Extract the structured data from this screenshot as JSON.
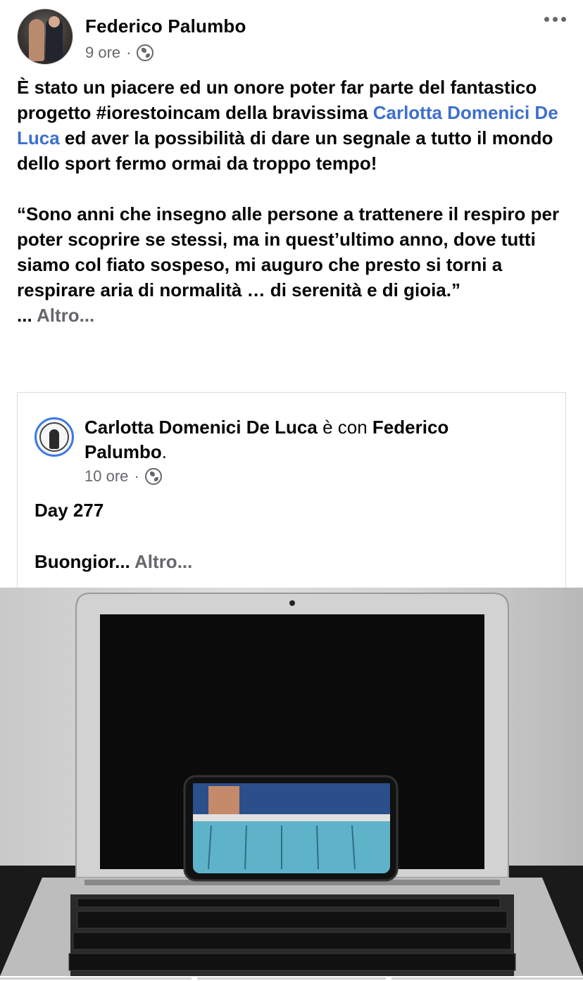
{
  "post": {
    "author": "Federico Palumbo",
    "time": "9 ore",
    "separator": "·",
    "privacy_icon": "globe-icon",
    "more_icon": "more-options-icon",
    "text_line1": "È stato un piacere ed un onore poter far parte del fantastico progetto #iorestoincam della bravissima ",
    "mention": "Carlotta Domenici De Luca",
    "text_line2": " ed aver la possibilità di dare un segnale a tutto il mondo dello sport fermo ormai da troppo tempo!",
    "quote": "“Sono anni che insegno alle persone a trattenere il respiro per poter scoprire se stessi, ma in quest’ultimo anno, dove tutti siamo col fiato sospeso, mi auguro che presto si torni a respirare aria di normalità … di serenità e di gioia.”",
    "ellipsis": "... ",
    "see_more": "Altro..."
  },
  "shared_post": {
    "author": "Carlotta Domenici De Luca",
    "with_text": " è con ",
    "tagged": "Federico Palumbo",
    "period": ".",
    "time": "10 ore",
    "separator": "·",
    "privacy_icon": "globe-icon",
    "day": "Day 277",
    "body": "Buongior... ",
    "see_more": "Altro..."
  },
  "photo": {
    "description_icon": "laptop-with-phone-photo",
    "colors": {
      "screen": "#0a0a0a",
      "body": "#c8c8c8",
      "pool": "#5fb3c9"
    }
  },
  "colors": {
    "link": "#3d6fcf",
    "muted": "#65676b",
    "text": "#050505"
  }
}
